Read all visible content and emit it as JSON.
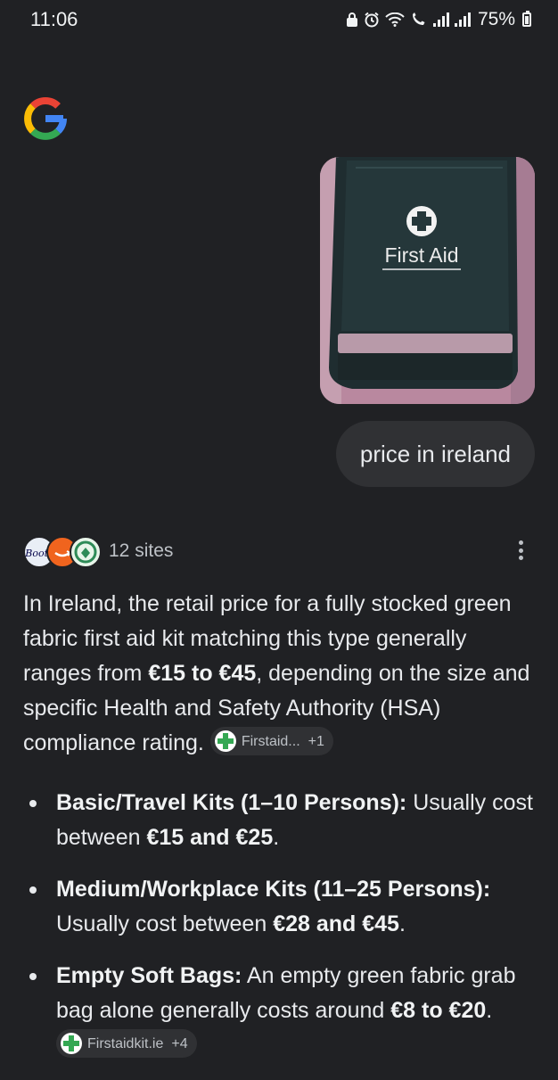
{
  "status_bar": {
    "time": "11:06",
    "battery": "75%",
    "icons": [
      "lock-icon",
      "alarm-icon",
      "wifi-icon",
      "wifi-calling-icon",
      "signal-icon",
      "signal-icon",
      "battery-icon"
    ]
  },
  "header": {
    "logo": "google-g-logo"
  },
  "conversation": {
    "image_label": "First Aid",
    "query": "price in ireland"
  },
  "sources": {
    "count_label": "12 sites",
    "favicons": [
      "Boots",
      "amazon",
      "green-site"
    ]
  },
  "answer": {
    "intro_1": "In Ireland, the retail price for a fully stocked green fabric first aid kit matching this type generally ranges from ",
    "intro_bold": "€15 to €45",
    "intro_2": ", depending on the size and specific Health and Safety Authority (HSA) compliance rating.",
    "intro_chip": {
      "label": "Firstaid...",
      "extra": "+1"
    },
    "bullets": [
      {
        "title": "Basic/Travel Kits (1–10 Persons):",
        "text": " Usually cost between ",
        "bold": "€15 and €25",
        "tail": "."
      },
      {
        "title": "Medium/Workplace Kits (11–25 Persons):",
        "text": " Usually cost between ",
        "bold": "€28 and €45",
        "tail": "."
      },
      {
        "title": "Empty Soft Bags:",
        "text": " An empty green fabric grab bag alone generally costs around ",
        "bold": "€8 to €20",
        "tail": ".",
        "chip": {
          "label": "Firstaidkit.ie",
          "extra": "+4"
        }
      }
    ]
  },
  "colors": {
    "background": "#202124",
    "bubble": "#303134",
    "text": "#e8eaed",
    "muted": "#bdc1c6",
    "chip_icon": "#34a853"
  }
}
